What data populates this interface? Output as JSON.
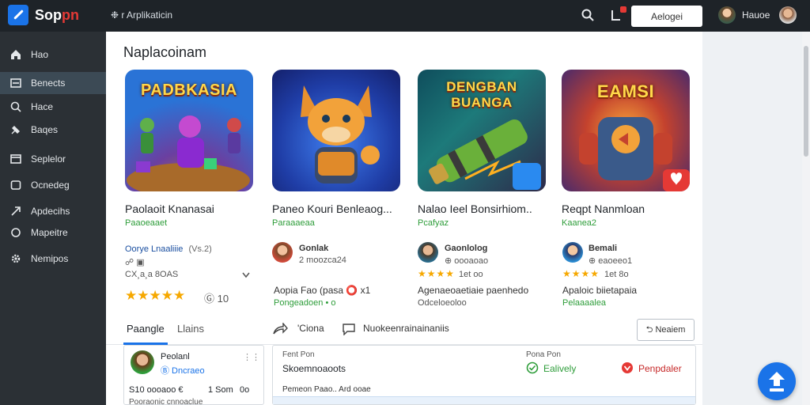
{
  "app": {
    "logo_main": "Sop",
    "logo_accent": "pn",
    "tag": "❉ r Arplikaticin"
  },
  "topbar": {
    "button_label": "Aelogei",
    "user_name": "Hauoe"
  },
  "sidebar": {
    "items": [
      {
        "label": "Hao",
        "icon": "home-icon"
      },
      {
        "label": "Benects",
        "icon": "grid-icon"
      },
      {
        "label": "Hace",
        "icon": "search-icon"
      },
      {
        "label": "Baqes",
        "icon": "pin-icon"
      },
      {
        "label": "Seplelor",
        "icon": "window-icon"
      },
      {
        "label": "Ocnedeg",
        "icon": "folder-icon"
      },
      {
        "label": "Apdecihs",
        "icon": "arrow-icon"
      },
      {
        "label": "Mapeitre",
        "icon": "circle-icon"
      },
      {
        "label": "Nemipos",
        "icon": "gear-icon"
      }
    ]
  },
  "section": {
    "title": "Naplacoinam"
  },
  "cards": [
    {
      "art_text": "PADBKASIA",
      "title": "Paolaoit Knanasai",
      "category": "Paaoeaaet",
      "line1": "Oorye Lnaaliiie",
      "line1b": "(Vs.2)",
      "line2": "CX¸a¸a 8OAS",
      "rating_text": "Ⓖ 10",
      "color": "#6b3fa0"
    },
    {
      "art_text": "",
      "title": "Paneo Kouri Benleaog...",
      "category": "Paraaaeaa",
      "dev": "Gonlak",
      "dev_sub": "2 moozca24",
      "price_line": "Aopia Fao (pasa ⭕ x1",
      "status_line": "Pongeadoen • o",
      "color": "#1f3da6"
    },
    {
      "art_text": "DENGBAN BUANGA",
      "title": "Nalao Ieel Bonsirhiom..",
      "category": "Pcafyaz",
      "dev": "Gaonlolog",
      "dev_sub": "⊕ oooaoao",
      "rating_line": "1et oo",
      "price_line": "Agenaeoaetiaie paenhedo",
      "status_line": "Odceloeoloo",
      "color": "#1d7a7a"
    },
    {
      "art_text": "EAMSI",
      "title": "Reqpt Nanmloan",
      "category": "Kaanea2",
      "dev": "Bemali",
      "dev_sub": "⊕ eaoeeo1",
      "rating_line": "1et 8o",
      "price_line": "Apaloic biietapaia",
      "status_line": "Pelaaaalea",
      "color": "#c4422e"
    }
  ],
  "tabs": {
    "primary": "Paangle",
    "secondary": "Llains"
  },
  "actions": {
    "share": "'Ciona",
    "comment": "Nuokeenrainainaniis",
    "button": "⮌ Neaiem"
  },
  "panel_left": {
    "name": "Peolanl",
    "handle": "Ⓑ Dncraeo",
    "stats": "S10 oooaoo €",
    "stats2": "1 Som",
    "stats3": "0o",
    "footer": "Pooraonic cnnoaclue"
  },
  "panel_right": {
    "col1_label": "Fent Pon",
    "col1_value": "Skoemnoaoots",
    "col2_label": "Pona Pon",
    "col2_value": "Ealively",
    "col3_value": "Penpdaler",
    "footer": "Pemeon Paao.. Ard ooae"
  }
}
